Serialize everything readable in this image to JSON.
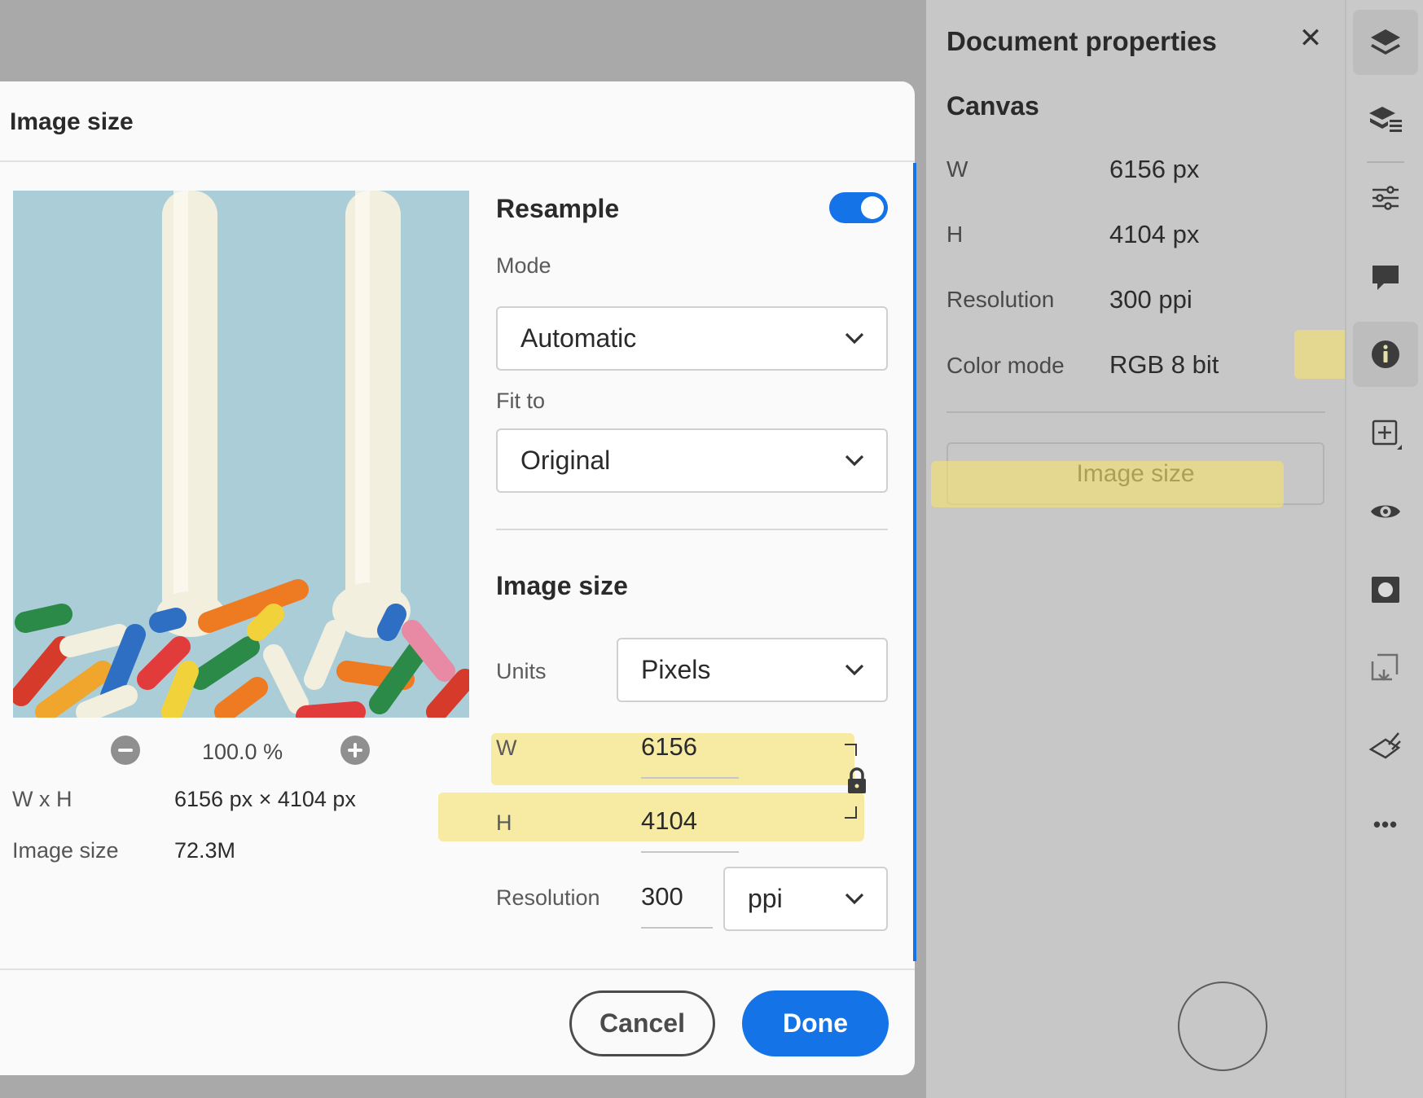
{
  "properties_panel": {
    "title": "Document properties",
    "close_glyph": "✕",
    "section": "Canvas",
    "rows": [
      {
        "label": "W",
        "value": "6156 px"
      },
      {
        "label": "H",
        "value": "4104 px"
      },
      {
        "label": "Resolution",
        "value": "300 ppi"
      },
      {
        "label": "Color mode",
        "value": "RGB  8 bit"
      }
    ],
    "image_size_button": "Image size"
  },
  "toolbar": {
    "tools": [
      "layers-icon",
      "layer-properties-icon",
      "adjustments-icon",
      "comments-icon",
      "info-icon",
      "add-layer-icon",
      "visibility-icon",
      "mask-icon",
      "crop-icon",
      "brush-icon",
      "more-icon"
    ],
    "active_tool": "info-icon",
    "more_glyph": "•••"
  },
  "dialog": {
    "title": "Image size",
    "zoom": "100.0 %",
    "wxh_label": "W x H",
    "wxh_value": "6156 px  ×  4104 px",
    "size_label": "Image size",
    "size_value": "72.3M",
    "resample": {
      "label": "Resample",
      "enabled": true
    },
    "mode": {
      "label": "Mode",
      "value": "Automatic"
    },
    "fit_to": {
      "label": "Fit to",
      "value": "Original"
    },
    "image_size_section": "Image size",
    "units": {
      "label": "Units",
      "value": "Pixels"
    },
    "width": {
      "label": "W",
      "value": "6156"
    },
    "height": {
      "label": "H",
      "value": "4104"
    },
    "resolution": {
      "label": "Resolution",
      "value": "300",
      "unit": "ppi"
    },
    "cancel_label": "Cancel",
    "done_label": "Done"
  },
  "colors": {
    "accent": "#1473e6",
    "highlight": "#f6e26e"
  }
}
